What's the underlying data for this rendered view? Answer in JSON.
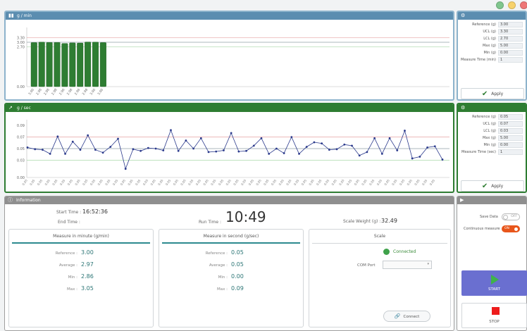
{
  "window_controls": [
    {
      "name": "minimize",
      "color": "#7fc68d"
    },
    {
      "name": "maximize",
      "color": "#f7d26b"
    },
    {
      "name": "close",
      "color": "#ee7777"
    }
  ],
  "panels": {
    "g_min": {
      "title": "g / min"
    },
    "g_sec": {
      "title": "g / sec"
    },
    "information": {
      "title": "Information"
    }
  },
  "settings_min": {
    "rows": [
      {
        "label": "Reference (g)",
        "value": "3.00"
      },
      {
        "label": "UCL (g)",
        "value": "3.30"
      },
      {
        "label": "LCL (g)",
        "value": "2.70"
      },
      {
        "label": "Max (g)",
        "value": "5.00"
      },
      {
        "label": "Min (g)",
        "value": "0.00"
      },
      {
        "label": "Measure Time (min)",
        "value": "1"
      }
    ],
    "apply_label": "Apply"
  },
  "settings_sec": {
    "rows": [
      {
        "label": "Reference (g)",
        "value": "0.05"
      },
      {
        "label": "UCL (g)",
        "value": "0.07"
      },
      {
        "label": "LCL (g)",
        "value": "0.03"
      },
      {
        "label": "Max (g)",
        "value": "5.00"
      },
      {
        "label": "Min (g)",
        "value": "0.00"
      },
      {
        "label": "Measure Time (sec)",
        "value": "1"
      }
    ],
    "apply_label": "Apply"
  },
  "info": {
    "start_time_label": "Start Time :",
    "start_time": "16:52:36",
    "end_time_label": "End Time :",
    "end_time": "",
    "run_time_label": "Run Time :",
    "run_time": "10:49",
    "scale_weight_label": "Scale Weight (g) :",
    "scale_weight": "32.49"
  },
  "measure_min": {
    "title": "Measure in minute (g/min)",
    "rows": [
      {
        "label": "Reference :",
        "value": "3.00"
      },
      {
        "label": "Average :",
        "value": "2.97"
      },
      {
        "label": "Min :",
        "value": "2.86"
      },
      {
        "label": "Max :",
        "value": "3.05"
      }
    ]
  },
  "measure_sec": {
    "title": "Measure in second (g/sec)",
    "rows": [
      {
        "label": "Reference :",
        "value": "0.05"
      },
      {
        "label": "Average :",
        "value": "0.05"
      },
      {
        "label": "Min :",
        "value": "0.00"
      },
      {
        "label": "Max :",
        "value": "0.09"
      }
    ]
  },
  "scale": {
    "title": "Scale",
    "status": "Connected",
    "status_color": "#3fa24a",
    "com_port_label": "COM Port",
    "com_port_value": "",
    "connect_label": "Connect"
  },
  "controls": {
    "save_data_label": "Save Data",
    "save_data_state": "OFF",
    "continuous_label": "Continuous measure",
    "continuous_state": "ON",
    "start_label": "START",
    "stop_label": "STOP",
    "start_color": "#6a6fd0",
    "stop_color": "#ee1c1c"
  },
  "chart_data": [
    {
      "type": "bar",
      "title": "g / min",
      "color": "#2e7d32",
      "categories": [
        "3.00",
        "2.98",
        "2.98",
        "2.98",
        "2.96",
        "2.98",
        "2.96",
        "2.98",
        "3.00",
        "3.00"
      ],
      "values": [
        2.98,
        3.01,
        2.99,
        2.99,
        2.92,
        2.96,
        2.95,
        3.02,
        3.01,
        2.98
      ],
      "ylim": [
        0,
        4
      ],
      "yticks": [
        "3.00",
        "2.70",
        "3.30",
        "0.00"
      ],
      "reference_lines": [
        {
          "name": "Reference",
          "value": 3.0,
          "color": "#8f9fa8"
        },
        {
          "name": "UCL",
          "value": 3.3,
          "color": "#e5a3a3"
        },
        {
          "name": "LCL",
          "value": 2.7,
          "color": "#a8d8a8"
        }
      ]
    },
    {
      "type": "line",
      "title": "g / sec",
      "color": "#2b3a8c",
      "values": [
        0.052,
        0.049,
        0.048,
        0.041,
        0.071,
        0.041,
        0.062,
        0.048,
        0.073,
        0.048,
        0.043,
        0.053,
        0.067,
        0.015,
        0.049,
        0.046,
        0.051,
        0.05,
        0.047,
        0.082,
        0.046,
        0.064,
        0.05,
        0.068,
        0.044,
        0.045,
        0.047,
        0.077,
        0.045,
        0.046,
        0.055,
        0.068,
        0.041,
        0.05,
        0.042,
        0.07,
        0.041,
        0.053,
        0.061,
        0.059,
        0.048,
        0.049,
        0.057,
        0.055,
        0.038,
        0.044,
        0.068,
        0.041,
        0.068,
        0.047,
        0.081,
        0.033,
        0.036,
        0.052,
        0.054,
        0.031
      ],
      "ylim": [
        0,
        0.1
      ],
      "yticks": [
        "0.09",
        "0.07",
        "0.05",
        "0.03",
        "0.00"
      ],
      "xtick_label": "0.05",
      "reference_lines": [
        {
          "name": "Reference",
          "value": 0.05,
          "color": "#8f9fa8"
        },
        {
          "name": "UCL",
          "value": 0.07,
          "color": "#e5a3a3"
        },
        {
          "name": "LCL",
          "value": 0.03,
          "color": "#a8d8a8"
        }
      ]
    }
  ]
}
